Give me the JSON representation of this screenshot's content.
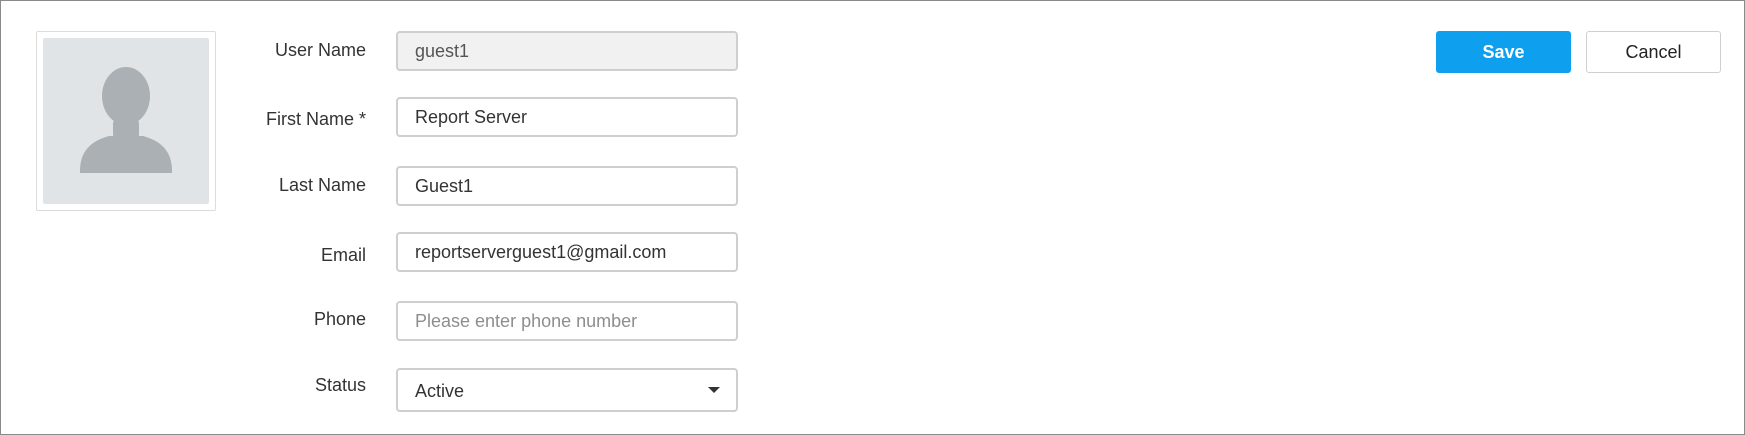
{
  "form": {
    "username": {
      "label": "User Name",
      "value": "guest1"
    },
    "first_name": {
      "label": "First Name *",
      "value": "Report Server"
    },
    "last_name": {
      "label": "Last Name",
      "value": "Guest1"
    },
    "email": {
      "label": "Email",
      "value": "reportserverguest1@gmail.com"
    },
    "phone": {
      "label": "Phone",
      "value": "",
      "placeholder": "Please enter phone number"
    },
    "status": {
      "label": "Status",
      "selected": "Active"
    }
  },
  "actions": {
    "save_label": "Save",
    "cancel_label": "Cancel"
  },
  "avatar": {
    "icon": "user-silhouette-icon"
  },
  "colors": {
    "primary": "#0ea0ee",
    "avatar_bg": "#e1e4e6",
    "silhouette": "#aab0b3"
  }
}
